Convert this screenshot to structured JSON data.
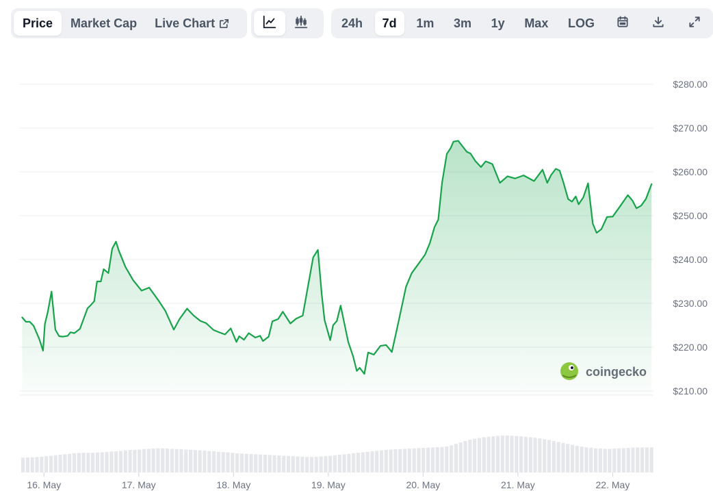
{
  "toolbar": {
    "view_tabs": [
      {
        "label": "Price",
        "active": true
      },
      {
        "label": "Market Cap",
        "active": false
      },
      {
        "label": "Live Chart",
        "active": false,
        "icon": "external-link-icon"
      }
    ],
    "chart_type_buttons": [
      {
        "icon": "line-chart-icon",
        "active": true
      },
      {
        "icon": "candlestick-chart-icon",
        "active": false
      }
    ],
    "ranges": [
      {
        "label": "24h",
        "active": false
      },
      {
        "label": "7d",
        "active": true
      },
      {
        "label": "1m",
        "active": false
      },
      {
        "label": "3m",
        "active": false
      },
      {
        "label": "1y",
        "active": false
      },
      {
        "label": "Max",
        "active": false
      },
      {
        "label": "LOG",
        "active": false
      }
    ],
    "tool_icons": [
      "calendar-icon",
      "download-icon",
      "expand-icon"
    ]
  },
  "watermark": "coingecko",
  "colors": {
    "line": "#16a34a",
    "fill": "#16a34a",
    "volume": "#e5e7eb",
    "grid": "#eceef1",
    "axis_text": "#6b7280"
  },
  "chart_data": {
    "type": "area",
    "title": "",
    "xlabel": "",
    "ylabel": "",
    "grid": true,
    "ylim": [
      205,
      283
    ],
    "xlim": [
      15.76,
      22.43
    ],
    "y_ticks": [
      {
        "value": 210,
        "label": "$210.00"
      },
      {
        "value": 220,
        "label": "$220.00"
      },
      {
        "value": 230,
        "label": "$230.00"
      },
      {
        "value": 240,
        "label": "$240.00"
      },
      {
        "value": 250,
        "label": "$250.00"
      },
      {
        "value": 260,
        "label": "$260.00"
      },
      {
        "value": 270,
        "label": "$270.00"
      },
      {
        "value": 280,
        "label": "$280.00"
      }
    ],
    "x_ticks": [
      {
        "value": 16,
        "label": "16. May"
      },
      {
        "value": 17,
        "label": "17. May"
      },
      {
        "value": 18,
        "label": "18. May"
      },
      {
        "value": 19,
        "label": "19. May"
      },
      {
        "value": 20,
        "label": "20. May"
      },
      {
        "value": 21,
        "label": "21. May"
      },
      {
        "value": 22,
        "label": "22. May"
      }
    ],
    "series": [
      {
        "x": [
          15.77,
          15.81,
          15.85,
          15.89,
          15.95,
          15.99,
          16.01,
          16.04,
          16.08,
          16.12,
          16.16,
          16.2,
          16.25,
          16.28,
          16.32,
          16.38,
          16.46,
          16.49,
          16.53,
          16.56,
          16.6,
          16.63,
          16.68,
          16.72,
          16.76,
          16.79,
          16.86,
          16.94,
          17.03,
          17.11,
          17.21,
          17.28,
          17.37,
          17.43,
          17.51,
          17.58,
          17.65,
          17.71,
          17.79,
          17.86,
          17.91,
          17.97,
          18.03,
          18.06,
          18.11,
          18.16,
          18.23,
          18.28,
          18.31,
          18.37,
          18.41,
          18.47,
          18.52,
          18.6,
          18.66,
          18.73,
          18.78,
          18.84,
          18.89,
          18.93,
          18.96,
          19.02,
          19.05,
          19.09,
          19.13,
          19.21,
          19.26,
          19.3,
          19.33,
          19.38,
          19.42,
          19.48,
          19.55,
          19.61,
          19.67,
          19.74,
          19.82,
          19.88,
          19.94,
          20.02,
          20.07,
          20.12,
          20.16,
          20.2,
          20.25,
          20.29,
          20.32,
          20.37,
          20.42,
          20.46,
          20.5,
          20.55,
          20.61,
          20.66,
          20.73,
          20.81,
          20.89,
          20.97,
          21.06,
          21.17,
          21.26,
          21.31,
          21.35,
          21.4,
          21.44,
          21.48,
          21.53,
          21.57,
          21.61,
          21.64,
          21.69,
          21.74,
          21.79,
          21.83,
          21.88,
          21.94,
          22.0,
          22.07,
          22.16,
          22.21,
          22.25,
          22.3,
          22.35,
          22.41
        ],
        "y": [
          226.8,
          225.8,
          225.8,
          224.9,
          221.9,
          219.2,
          225.3,
          228.0,
          232.7,
          224.0,
          222.5,
          222.4,
          222.6,
          223.4,
          223.2,
          224.2,
          228.9,
          229.5,
          230.5,
          235.0,
          235.0,
          237.8,
          236.9,
          242.5,
          244.1,
          242.0,
          238.3,
          235.3,
          232.9,
          233.6,
          230.6,
          228.3,
          224.0,
          226.4,
          228.8,
          227.2,
          226.0,
          225.5,
          223.9,
          223.3,
          222.9,
          224.3,
          221.2,
          222.5,
          221.7,
          223.2,
          222.2,
          222.6,
          221.4,
          222.4,
          225.9,
          226.4,
          228.1,
          225.4,
          226.5,
          227.2,
          233.3,
          240.5,
          242.2,
          232.2,
          226.2,
          221.6,
          225.0,
          226.0,
          229.5,
          221.2,
          218.0,
          214.6,
          215.3,
          213.9,
          218.8,
          218.3,
          220.3,
          220.5,
          218.9,
          225.8,
          233.8,
          236.9,
          238.7,
          241.1,
          243.7,
          247.4,
          249.1,
          257.6,
          264.1,
          265.4,
          266.9,
          267.1,
          265.7,
          264.6,
          264.2,
          262.5,
          261.1,
          262.4,
          261.8,
          257.5,
          259.0,
          258.5,
          259.2,
          257.9,
          260.5,
          257.5,
          259.3,
          260.7,
          260.3,
          257.6,
          253.8,
          253.2,
          254.4,
          252.6,
          254.2,
          257.4,
          248.2,
          246.1,
          246.9,
          249.7,
          249.8,
          251.9,
          254.7,
          253.4,
          251.7,
          252.3,
          253.8,
          257.2
        ]
      }
    ],
    "volume": {
      "x_start": 15.76,
      "x_end": 22.44,
      "relative_values": [
        0.6,
        0.61,
        0.62,
        0.63,
        0.64,
        0.66,
        0.68,
        0.7,
        0.72,
        0.74,
        0.76,
        0.78,
        0.79,
        0.8,
        0.8,
        0.8,
        0.81,
        0.82,
        0.83,
        0.85,
        0.86,
        0.88,
        0.9,
        0.91,
        0.92,
        0.93,
        0.95,
        0.96,
        0.97,
        0.98,
        0.98,
        0.97,
        0.96,
        0.95,
        0.94,
        0.93,
        0.92,
        0.91,
        0.9,
        0.89,
        0.87,
        0.86,
        0.84,
        0.83,
        0.82,
        0.8,
        0.78,
        0.77,
        0.76,
        0.75,
        0.74,
        0.73,
        0.72,
        0.71,
        0.7,
        0.69,
        0.68,
        0.67,
        0.66,
        0.65,
        0.64,
        0.63,
        0.63,
        0.64,
        0.65,
        0.66,
        0.68,
        0.7,
        0.72,
        0.74,
        0.76,
        0.78,
        0.8,
        0.82,
        0.84,
        0.86,
        0.88,
        0.9,
        0.92,
        0.93,
        0.94,
        0.95,
        0.96,
        0.97,
        0.98,
        0.99,
        1.0,
        1.01,
        1.02,
        1.03,
        1.04,
        1.06,
        1.1,
        1.16,
        1.22,
        1.28,
        1.33,
        1.37,
        1.4,
        1.43,
        1.45,
        1.47,
        1.49,
        1.5,
        1.5,
        1.49,
        1.48,
        1.47,
        1.45,
        1.43,
        1.41,
        1.38,
        1.35,
        1.32,
        1.28,
        1.24,
        1.2,
        1.16,
        1.12,
        1.08,
        1.05,
        1.02,
        1.0,
        0.98,
        0.97,
        0.96,
        0.96,
        0.97,
        0.98,
        0.99,
        1.0,
        1.01,
        1.02,
        1.02,
        1.02,
        1.02
      ]
    }
  }
}
